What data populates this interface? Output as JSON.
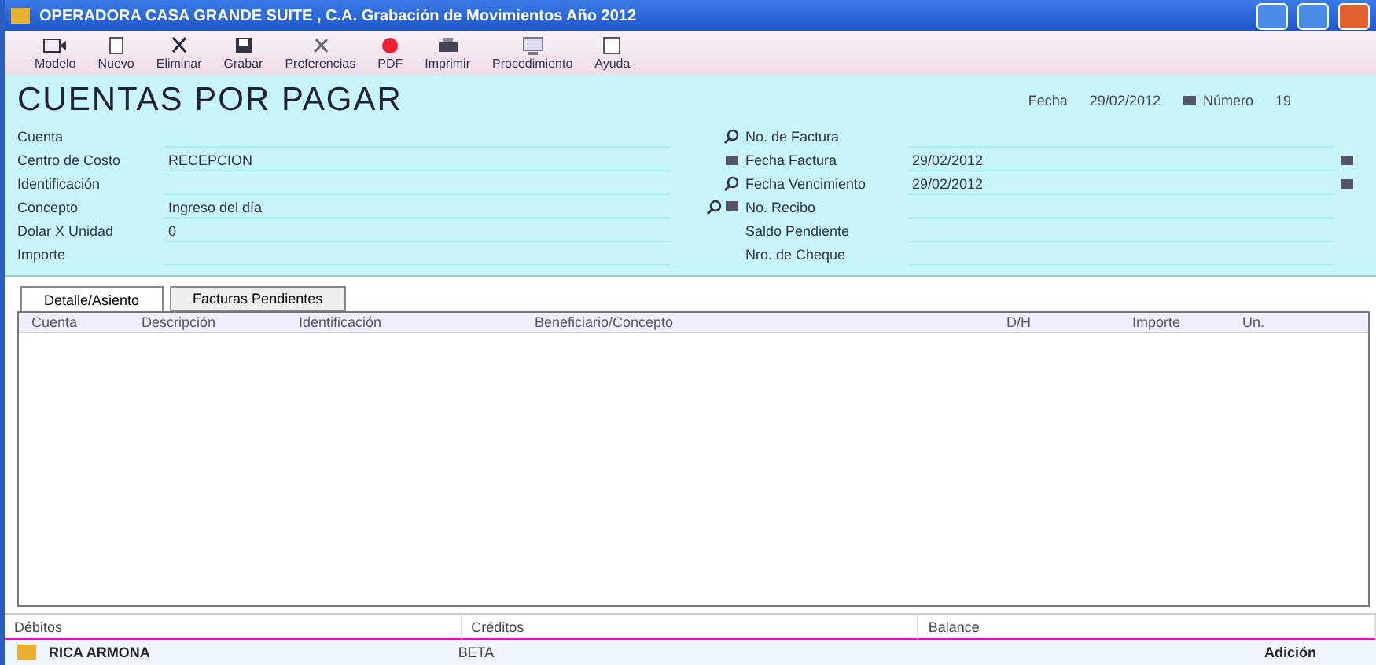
{
  "window": {
    "title": "OPERADORA CASA GRANDE SUITE , C.A. Grabación de Movimientos Año 2012"
  },
  "toolbar": [
    {
      "label": "Modelo"
    },
    {
      "label": "Nuevo"
    },
    {
      "label": "Eliminar"
    },
    {
      "label": "Grabar"
    },
    {
      "label": "Preferencias"
    },
    {
      "label": "PDF"
    },
    {
      "label": "Imprimir"
    },
    {
      "label": "Procedimiento"
    },
    {
      "label": "Ayuda"
    }
  ],
  "form": {
    "heading": "CUENTAS POR PAGAR",
    "fecha_label": "Fecha",
    "fecha": "29/02/2012",
    "numero_label": "Número",
    "numero": "19",
    "left_fields": [
      {
        "label": "Cuenta"
      },
      {
        "label": "Centro de Costo",
        "value": "RECEPCION"
      },
      {
        "label": "Identificación"
      },
      {
        "label": "Concepto",
        "value": "Ingreso del día"
      },
      {
        "label": "Dolar X Unidad",
        "value": "0"
      },
      {
        "label": "Importe"
      }
    ],
    "right_fields": [
      {
        "label": "No. de Factura",
        "kind": "lookup"
      },
      {
        "label": "Fecha Factura",
        "value": "29/02/2012",
        "kind": "date"
      },
      {
        "label": "Fecha Vencimiento",
        "value": "29/02/2012",
        "kind": "lookupdate"
      },
      {
        "label": "No. Recibo",
        "kind": "lookupcalendar"
      },
      {
        "label": "Saldo Pendiente",
        "kind": "plain"
      },
      {
        "label": "Nro. de Cheque",
        "kind": "plain"
      }
    ]
  },
  "tabs": [
    {
      "label": "Detalle/Asiento",
      "selected": true
    },
    {
      "label": "Facturas Pendientes",
      "selected": false
    }
  ],
  "table": {
    "columns": [
      "Cuenta",
      "Descripción",
      "Identificación",
      "Beneficiario/Concepto",
      "D/H",
      "Importe",
      "Un."
    ]
  },
  "totals": [
    {
      "label": "Débitos"
    },
    {
      "label": "Créditos"
    },
    {
      "label": "Balance"
    }
  ],
  "status_bar": {
    "user": "RICA ARMONA",
    "mode": "BETA",
    "action": "Adición"
  }
}
